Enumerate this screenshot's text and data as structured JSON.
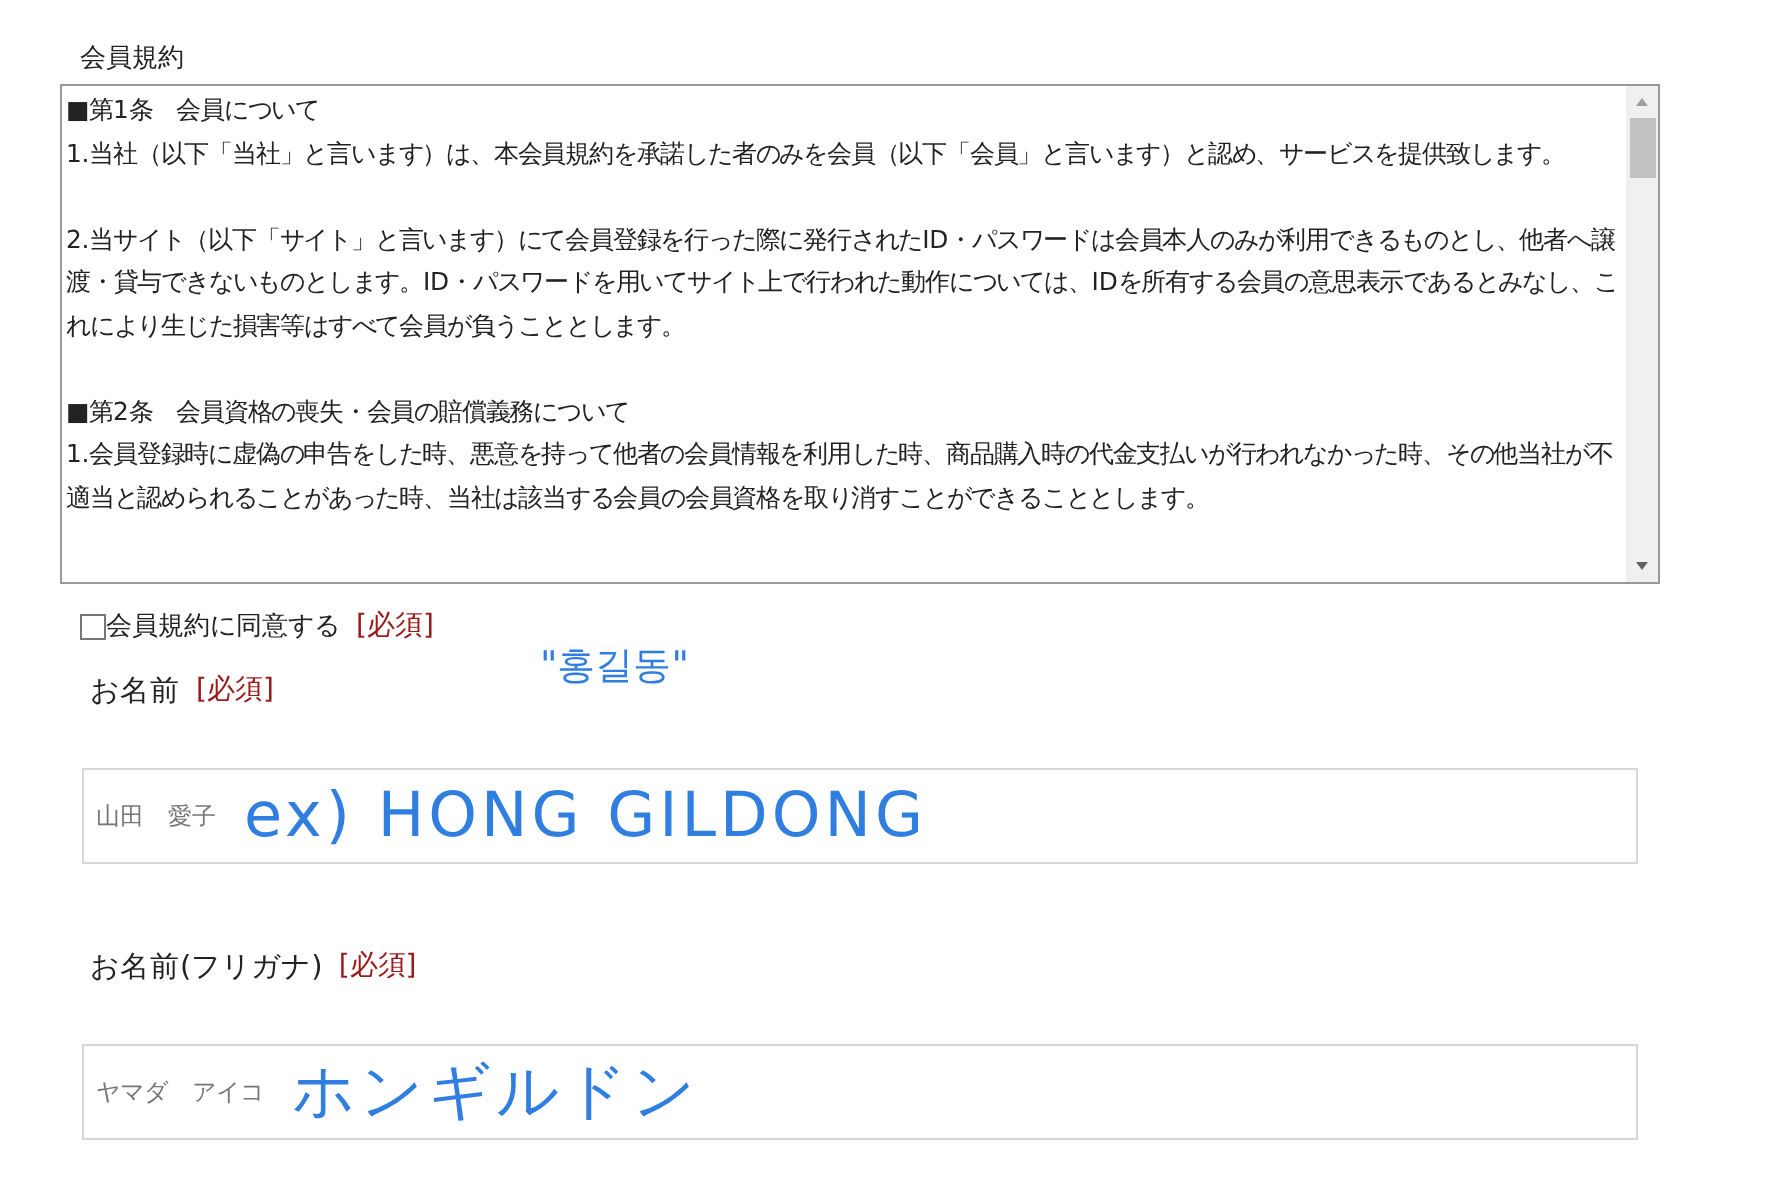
{
  "terms": {
    "label": "会員規約",
    "articles": [
      {
        "heading": "■第1条　会員について",
        "paragraphs": [
          "1.当社（以下「当社」と言います）は、本会員規約を承諾した者のみを会員（以下「会員」と言います）と認め、サービスを提供致します。",
          "2.当サイト（以下「サイト」と言います）にて会員登録を行った際に発行されたID・パスワードは会員本人のみが利用できるものとし、他者へ譲渡・貸与できないものとします。ID・パスワードを用いてサイト上で行われた動作については、IDを所有する会員の意思表示であるとみなし、これにより生じた損害等はすべて会員が負うこととします。"
        ]
      },
      {
        "heading": "■第2条　会員資格の喪失・会員の賠償義務について",
        "paragraphs": [
          "1.会員登録時に虚偽の申告をした時、悪意を持って他者の会員情報を利用した時、商品購入時の代金支払いが行われなかった時、その他当社が不適当と認められることがあった時、当社は該当する会員の会員資格を取り消すことができることとします。"
        ]
      }
    ]
  },
  "agree": {
    "label": "会員規約に同意する",
    "required": "[必須]",
    "checked": false
  },
  "fields": [
    {
      "label": "お名前",
      "required": "[必須]",
      "placeholder": "山田　愛子",
      "annotation": "ex) HONG GILDONG",
      "note": "\"홍길동\""
    },
    {
      "label": "お名前(フリガナ)",
      "required": "[必須]",
      "placeholder": "ヤマダ　アイコ",
      "annotation": "ホンギルドン"
    }
  ]
}
